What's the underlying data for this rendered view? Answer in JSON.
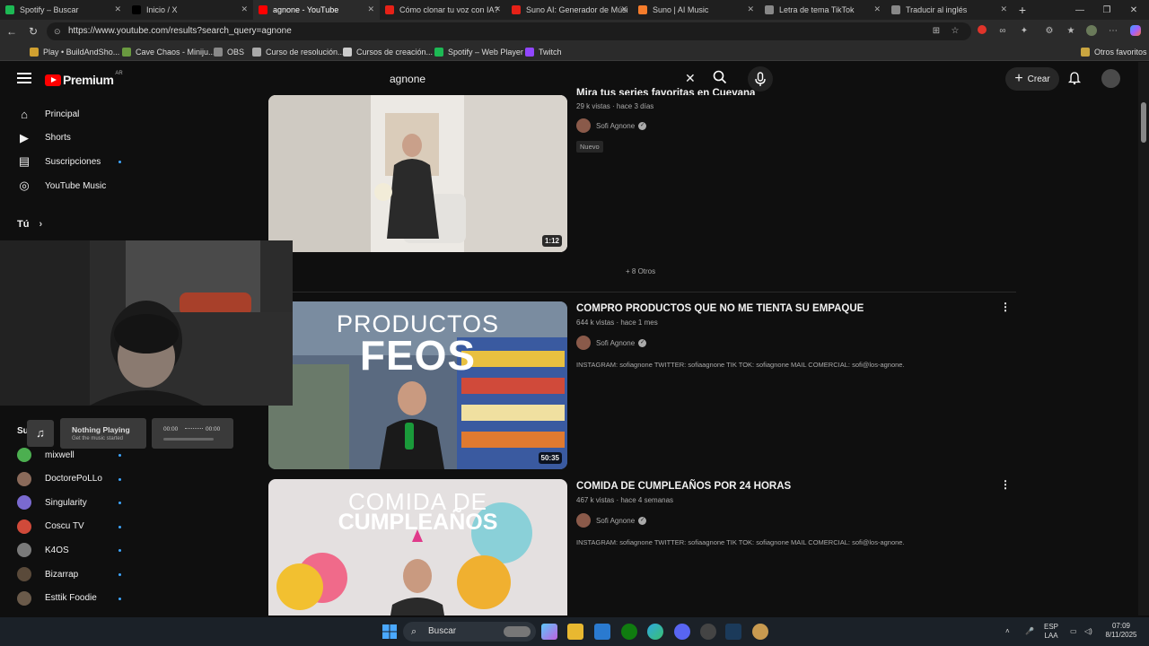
{
  "browser": {
    "tabs": [
      {
        "label": "Spotify – Buscar",
        "color": "#1db954",
        "active": false
      },
      {
        "label": "Inicio / X",
        "color": "#000000",
        "active": false
      },
      {
        "label": "agnone - YouTube",
        "color": "#ff0000",
        "active": true
      },
      {
        "label": "Cómo clonar tu voz con IA?",
        "color": "#e62117",
        "active": false
      },
      {
        "label": "Suno AI: Generador de Músi",
        "color": "#e62117",
        "active": false
      },
      {
        "label": "Suno | AI Music",
        "color": "#f57c2b",
        "active": false
      },
      {
        "label": "Letra de tema TikTok",
        "color": "#888888",
        "active": false
      },
      {
        "label": "Traducir al inglés",
        "color": "#888888",
        "active": false
      }
    ],
    "url": "https://www.youtube.com/results?search_query=agnone",
    "bookmarks": [
      {
        "label": "Play • BuildAndSho...",
        "color": "#d0a030"
      },
      {
        "label": "Cave Chaos - Miniju...",
        "color": "#6a9a40"
      },
      {
        "label": "OBS",
        "color": "#888888"
      },
      {
        "label": "Curso de resolución...",
        "color": "#aaaaaa"
      },
      {
        "label": "Cursos de creación...",
        "color": "#cccccc"
      },
      {
        "label": "Spotify – Web Player",
        "color": "#1db954"
      },
      {
        "label": "Twitch",
        "color": "#9146ff"
      }
    ],
    "other_bookmarks": "Otros favoritos"
  },
  "youtube": {
    "logo_text": "Premium",
    "logo_region": "AR",
    "search_value": "agnone",
    "create_label": "Crear",
    "sidebar": [
      {
        "label": "Principal",
        "icon": "home-icon"
      },
      {
        "label": "Shorts",
        "icon": "shorts-icon"
      },
      {
        "label": "Suscripciones",
        "icon": "subscriptions-icon"
      },
      {
        "label": "YouTube Music",
        "icon": "music-icon"
      }
    ],
    "you_label": "Tú",
    "subs_heading": "Su",
    "subscriptions": [
      {
        "label": "mixwell",
        "color": "#4caf50"
      },
      {
        "label": "DoctorePoLLo",
        "color": "#8a6a5a"
      },
      {
        "label": "Singularity",
        "color": "#7a6ad0"
      },
      {
        "label": "Coscu TV",
        "color": "#d04a3a"
      },
      {
        "label": "K4OS",
        "color": "#7a7a7a"
      },
      {
        "label": "Bizarrap",
        "color": "#5a4a3a"
      },
      {
        "label": "Esttik Foodie",
        "color": "#6a5a4a"
      }
    ],
    "videos": [
      {
        "title": "Mira tus series favoritas en Cuevana",
        "meta": "29 k vistas · hace 3 días",
        "channel": "Sofi Agnone",
        "badge": "Nuevo",
        "duration": "1:12"
      },
      {
        "title": "COMPRO PRODUCTOS QUE NO ME TIENTA SU EMPAQUE",
        "meta": "644 k vistas · hace 1 mes",
        "channel": "Sofi Agnone",
        "desc": "INSTAGRAM: sofiagnone TWITTER: sofiaagnone TIK TOK: sofiagnone MAIL COMERCIAL: sofi@los-agnone.",
        "duration": "50:35",
        "thumb_line1": "PRODUCTOS",
        "thumb_line2": "FEOS"
      },
      {
        "title": "COMIDA DE CUMPLEAÑOS POR 24 HORAS",
        "meta": "467 k vistas · hace 4 semanas",
        "channel": "Sofi Agnone",
        "desc": "INSTAGRAM: sofiagnone TWITTER: sofiaagnone TIK TOK: sofiagnone MAIL COMERCIAL: sofi@los-agnone.",
        "thumb_line1": "COMIDA DE",
        "thumb_line2": "CUMPLEAÑOS"
      }
    ],
    "more_label": "+ 8 Otros"
  },
  "now_playing": {
    "title": "Nothing Playing",
    "subtitle": "Get the music started",
    "time_start": "00:00",
    "time_end": "00:00"
  },
  "taskbar": {
    "search_label": "Buscar",
    "lang_top": "ESP",
    "lang_bottom": "LAA",
    "time": "07:09",
    "date": "8/11/2025"
  }
}
